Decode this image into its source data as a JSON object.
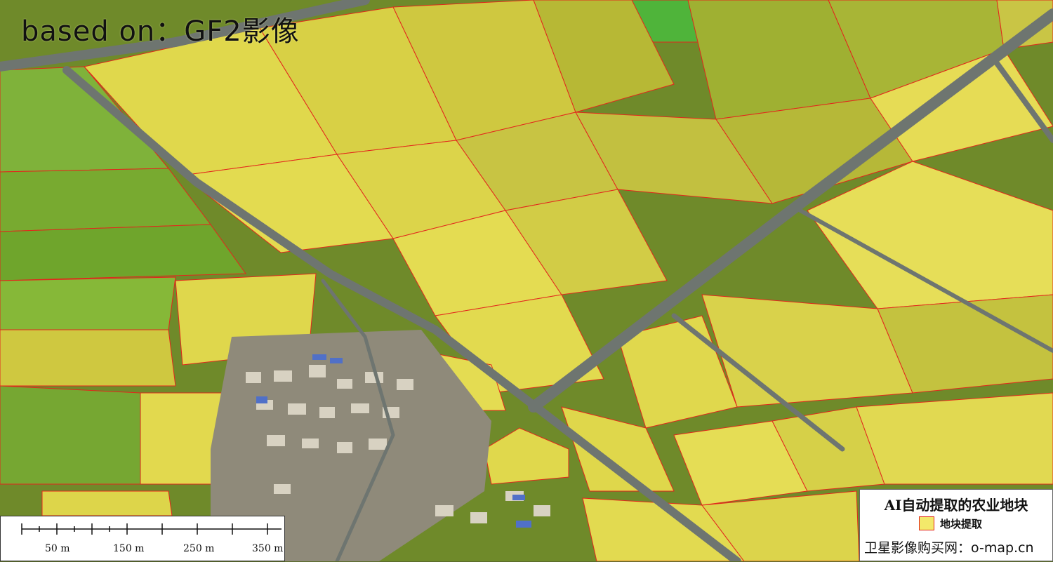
{
  "image": {
    "title": "based on：GF2影像"
  },
  "legend": {
    "title": "AI自动提取的农业地块",
    "item_label": "地块提取",
    "item_fill_color": "#f3e96a",
    "item_border_color": "#e3261c",
    "source": "卫星影像购买网：o-map.cn"
  },
  "scalebar": {
    "labels": [
      "50 m",
      "150 m",
      "250 m",
      "350 m"
    ]
  },
  "map": {
    "field_fill_color": "#e0d84c",
    "green_field_color": "#7fb23a",
    "road_color": "#6e7570",
    "boundary_color": "#e3261c",
    "village_color": "#8f8a7a"
  }
}
